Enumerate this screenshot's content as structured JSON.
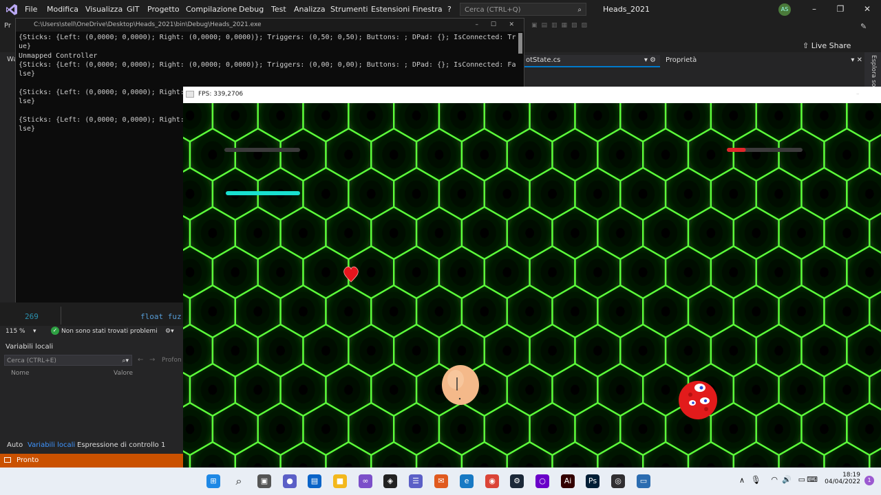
{
  "vs": {
    "menu": [
      "File",
      "Modifica",
      "Visualizza",
      "GIT",
      "Progetto",
      "Compilazione",
      "Debug",
      "Test",
      "Analizza",
      "Strumenti",
      "Estensioni",
      "Finestra",
      "?"
    ],
    "search_placeholder": "Cerca (CTRL+Q)",
    "solution_name": "Heads_2021",
    "avatar_initials": "AS",
    "live_share": "Live Share",
    "file_tab": "otState.cs",
    "properties_tab": "Proprietà",
    "explorer_label": "Esplora so",
    "left_tabs": [
      "Pr",
      "Wa"
    ],
    "accent": "#007acc"
  },
  "console": {
    "title": "C:\\Users\\stell\\OneDrive\\Desktop\\Heads_2021\\bin\\Debug\\Heads_2021.exe",
    "lines": [
      "{Sticks: {Left: (0,0000; 0,0000); Right: (0,0000; 0,0000)}; Triggers: (0,50; 0,50); Buttons: ; DPad: {}; IsConnected: Tr",
      "ue}",
      "Unmapped Controller",
      "{Sticks: {Left: (0,0000; 0,0000); Right: (0,0000; 0,0000)}; Triggers: (0,00; 0,00); Buttons: ; DPad: {}; IsConnected: Fa",
      "lse}",
      "",
      "{Sticks: {Left: (0,0000; 0,0000); Right:",
      "lse}",
      "",
      "{Sticks: {Left: (0,0000; 0,0000); Right:",
      "lse}"
    ]
  },
  "code": {
    "line_number": "269",
    "code_text": "float fuz"
  },
  "editor_status": {
    "zoom": "115 %",
    "problems": "Non sono stati trovati problemi"
  },
  "locals": {
    "title": "Variabili locali",
    "search_placeholder": "Cerca (CTRL+E)",
    "depth_label": "Profon",
    "col_name": "Nome",
    "col_value": "Valore",
    "tabs": [
      "Auto",
      "Variabili locali",
      "Espressione di controllo 1"
    ]
  },
  "statusbar": {
    "text": "Pronto",
    "color": "#ca5100"
  },
  "game": {
    "title": "FPS: 339,2706",
    "grid_color": "#5dff3a",
    "hud": {
      "player1_health_fraction": 0.0,
      "player1_energy_fraction": 1.0,
      "player2_health_fraction": 0.25,
      "energy_color": "#19e0d0",
      "health_color": "#e0262a"
    }
  },
  "taskbar": {
    "apps": [
      "start-icon",
      "search-icon",
      "task-view-icon",
      "teams-chat-icon",
      "store-icon",
      "file-explorer-icon",
      "visual-studio-icon",
      "unity-icon",
      "trello-icon",
      "mail-icon",
      "edge-icon",
      "chrome-icon",
      "steam-icon",
      "app-circle-icon",
      "illustrator-icon",
      "photoshop-icon",
      "obs-icon",
      "game-window-icon"
    ],
    "time": "18:19",
    "date": "04/04/2022",
    "notification_count": "1"
  }
}
